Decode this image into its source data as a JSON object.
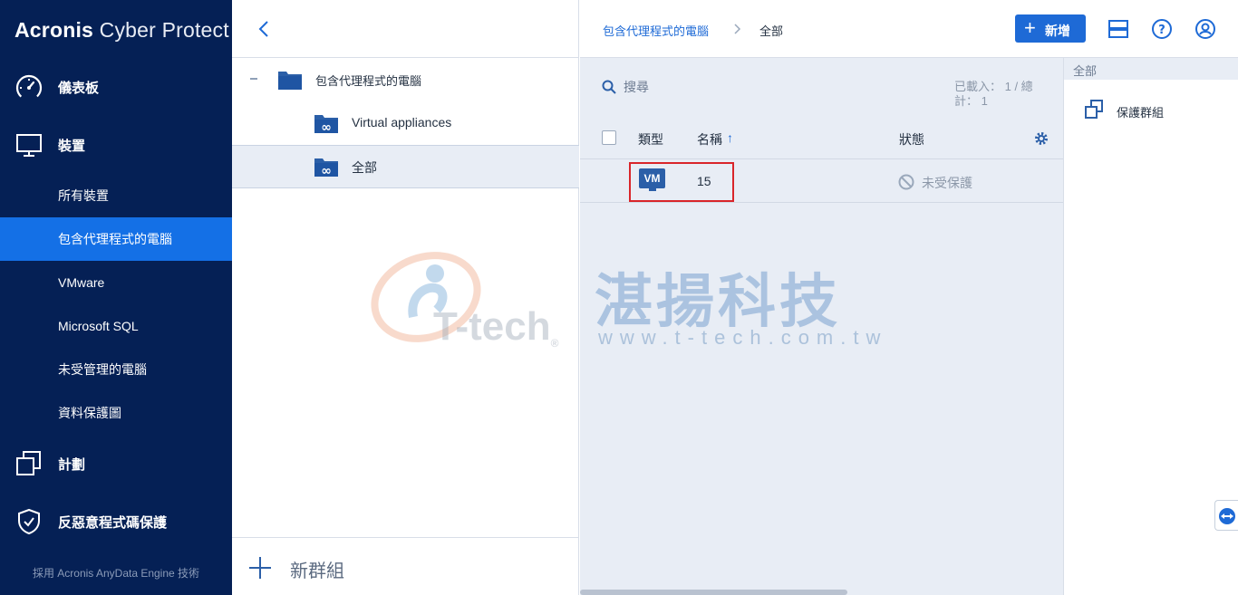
{
  "brand": {
    "bold": "Acronis",
    "rest": " Cyber Protect"
  },
  "sidebar": {
    "main": [
      {
        "label": "儀表板",
        "icon": "dashboard-gauge-icon"
      },
      {
        "label": "裝置",
        "icon": "monitor-icon"
      },
      {
        "label": "計劃",
        "icon": "plans-icon"
      },
      {
        "label": "反惡意程式碼保護",
        "icon": "shield-check-icon"
      }
    ],
    "sub": [
      {
        "label": "所有裝置",
        "active": false
      },
      {
        "label": "包含代理程式的電腦",
        "active": true
      },
      {
        "label": "VMware",
        "active": false
      },
      {
        "label": "Microsoft SQL",
        "active": false
      },
      {
        "label": "未受管理的電腦",
        "active": false
      },
      {
        "label": "資料保護圖",
        "active": false
      }
    ],
    "footer": "採用 Acronis AnyData Engine 技術"
  },
  "tree": {
    "root": {
      "label": "包含代理程式的電腦",
      "icon": "folder-icon"
    },
    "children": [
      {
        "label": "Virtual appliances",
        "icon": "dynamic-group-folder-icon",
        "selected": false
      },
      {
        "label": "全部",
        "icon": "dynamic-group-folder-icon",
        "selected": true
      }
    ],
    "new_group": "新群組"
  },
  "breadcrumb": {
    "parent": "包含代理程式的電腦",
    "current": "全部"
  },
  "toolbar": {
    "add_label": "新增"
  },
  "search": {
    "placeholder": "搜尋"
  },
  "loaded": {
    "line1": "已載入： 1 / 總",
    "line2": "計： 1"
  },
  "table": {
    "headers": {
      "type": "類型",
      "name": "名稱",
      "status": "狀態"
    },
    "sort_indicator": "↑",
    "rows": [
      {
        "type": "VM",
        "name": "15",
        "status": "未受保護"
      }
    ]
  },
  "watermark": {
    "name": "湛揚科技",
    "url": "www.t-tech.com.tw",
    "logo_text": "T-tech",
    "registered": "®"
  },
  "right_panel": {
    "title": "全部",
    "actions": [
      {
        "label": "保護群組",
        "icon": "protect-group-icon"
      }
    ]
  },
  "colors": {
    "sidebar": "#052055",
    "accent": "#1470e6",
    "highlight": "#d9252a"
  }
}
